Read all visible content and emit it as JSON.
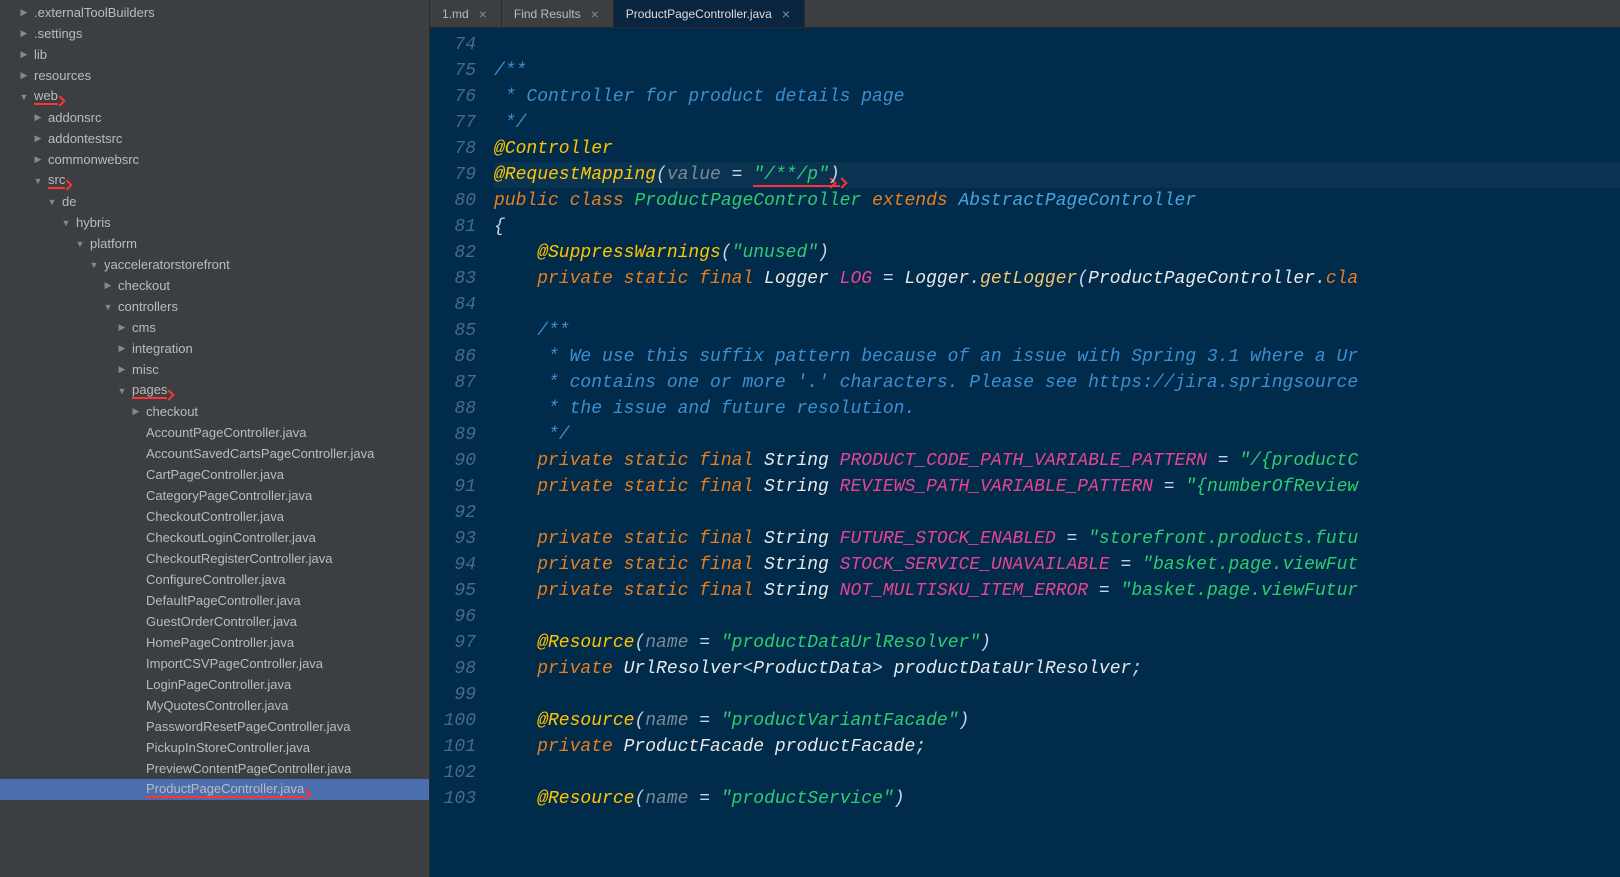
{
  "tabs": [
    {
      "label": "1.md",
      "active": false
    },
    {
      "label": "Find Results",
      "active": false
    },
    {
      "label": "ProductPageController.java",
      "active": true
    }
  ],
  "tree": [
    {
      "label": ".externalToolBuilders",
      "depth": 1,
      "arrow": "closed"
    },
    {
      "label": ".settings",
      "depth": 1,
      "arrow": "closed"
    },
    {
      "label": "lib",
      "depth": 1,
      "arrow": "closed"
    },
    {
      "label": "resources",
      "depth": 1,
      "arrow": "closed"
    },
    {
      "label": "web",
      "depth": 1,
      "arrow": "open",
      "red": true
    },
    {
      "label": "addonsrc",
      "depth": 2,
      "arrow": "closed"
    },
    {
      "label": "addontestsrc",
      "depth": 2,
      "arrow": "closed"
    },
    {
      "label": "commonwebsrc",
      "depth": 2,
      "arrow": "closed"
    },
    {
      "label": "src",
      "depth": 2,
      "arrow": "open",
      "red": true
    },
    {
      "label": "de",
      "depth": 3,
      "arrow": "open"
    },
    {
      "label": "hybris",
      "depth": 4,
      "arrow": "open"
    },
    {
      "label": "platform",
      "depth": 5,
      "arrow": "open"
    },
    {
      "label": "yacceleratorstorefront",
      "depth": 6,
      "arrow": "open"
    },
    {
      "label": "checkout",
      "depth": 7,
      "arrow": "closed"
    },
    {
      "label": "controllers",
      "depth": 7,
      "arrow": "open"
    },
    {
      "label": "cms",
      "depth": 8,
      "arrow": "closed"
    },
    {
      "label": "integration",
      "depth": 8,
      "arrow": "closed"
    },
    {
      "label": "misc",
      "depth": 8,
      "arrow": "closed"
    },
    {
      "label": "pages",
      "depth": 8,
      "arrow": "open",
      "red": true
    },
    {
      "label": "checkout",
      "depth": 9,
      "arrow": "closed"
    },
    {
      "label": "AccountPageController.java",
      "depth": 9
    },
    {
      "label": "AccountSavedCartsPageController.java",
      "depth": 9
    },
    {
      "label": "CartPageController.java",
      "depth": 9
    },
    {
      "label": "CategoryPageController.java",
      "depth": 9
    },
    {
      "label": "CheckoutController.java",
      "depth": 9
    },
    {
      "label": "CheckoutLoginController.java",
      "depth": 9
    },
    {
      "label": "CheckoutRegisterController.java",
      "depth": 9
    },
    {
      "label": "ConfigureController.java",
      "depth": 9
    },
    {
      "label": "DefaultPageController.java",
      "depth": 9
    },
    {
      "label": "GuestOrderController.java",
      "depth": 9
    },
    {
      "label": "HomePageController.java",
      "depth": 9
    },
    {
      "label": "ImportCSVPageController.java",
      "depth": 9
    },
    {
      "label": "LoginPageController.java",
      "depth": 9
    },
    {
      "label": "MyQuotesController.java",
      "depth": 9
    },
    {
      "label": "PasswordResetPageController.java",
      "depth": 9
    },
    {
      "label": "PickupInStoreController.java",
      "depth": 9
    },
    {
      "label": "PreviewContentPageController.java",
      "depth": 9
    },
    {
      "label": "ProductPageController.java",
      "depth": 9,
      "red": true,
      "selected": true
    }
  ],
  "code": {
    "lines": [
      {
        "n": 74,
        "tokens": []
      },
      {
        "n": 75,
        "tokens": [
          {
            "t": "/**",
            "c": "c-comment"
          }
        ]
      },
      {
        "n": 76,
        "tokens": [
          {
            "t": " * Controller for product details page",
            "c": "c-comment"
          }
        ]
      },
      {
        "n": 77,
        "tokens": [
          {
            "t": " */",
            "c": "c-comment"
          }
        ]
      },
      {
        "n": 78,
        "tokens": [
          {
            "t": "@Controller",
            "c": "c-annotation"
          }
        ]
      },
      {
        "n": 79,
        "hl": true,
        "tokens": [
          {
            "t": "@RequestMapping",
            "c": "c-annotation"
          },
          {
            "t": "(",
            "c": "c-punc"
          },
          {
            "t": "value ",
            "c": "c-gray"
          },
          {
            "t": "= ",
            "c": "c-punc"
          },
          {
            "t": "\"/**/p\"",
            "c": "c-string",
            "u": true
          },
          {
            "t": ")",
            "c": "c-punc",
            "u": true
          }
        ]
      },
      {
        "n": 80,
        "tokens": [
          {
            "t": "public ",
            "c": "c-keyword"
          },
          {
            "t": "class ",
            "c": "c-keyword"
          },
          {
            "t": "ProductPageController ",
            "c": "c-class"
          },
          {
            "t": "extends ",
            "c": "c-keyword"
          },
          {
            "t": "AbstractPageController",
            "c": "c-classref"
          }
        ]
      },
      {
        "n": 81,
        "tokens": [
          {
            "t": "{",
            "c": "c-punc"
          }
        ]
      },
      {
        "n": 82,
        "tokens": [
          {
            "t": "    @SuppressWarnings",
            "c": "c-annotation"
          },
          {
            "t": "(",
            "c": "c-punc"
          },
          {
            "t": "\"unused\"",
            "c": "c-string"
          },
          {
            "t": ")",
            "c": "c-punc"
          }
        ]
      },
      {
        "n": 83,
        "tokens": [
          {
            "t": "    private static final ",
            "c": "c-keyword"
          },
          {
            "t": "Logger ",
            "c": "c-white"
          },
          {
            "t": "LOG ",
            "c": "c-field"
          },
          {
            "t": "= ",
            "c": "c-punc"
          },
          {
            "t": "Logger",
            "c": "c-white"
          },
          {
            "t": ".",
            "c": "c-punc"
          },
          {
            "t": "getLogger",
            "c": "c-method"
          },
          {
            "t": "(",
            "c": "c-punc"
          },
          {
            "t": "ProductPageController",
            "c": "c-white"
          },
          {
            "t": ".",
            "c": "c-punc"
          },
          {
            "t": "cla",
            "c": "c-keyword"
          }
        ]
      },
      {
        "n": 84,
        "tokens": []
      },
      {
        "n": 85,
        "tokens": [
          {
            "t": "    /**",
            "c": "c-comment"
          }
        ]
      },
      {
        "n": 86,
        "tokens": [
          {
            "t": "     * We use this suffix pattern because of an issue with Spring 3.1 where a Ur",
            "c": "c-comment"
          }
        ]
      },
      {
        "n": 87,
        "tokens": [
          {
            "t": "     * contains one or more '.' characters. Please see https://jira.springsource",
            "c": "c-comment"
          }
        ]
      },
      {
        "n": 88,
        "tokens": [
          {
            "t": "     * the issue and future resolution.",
            "c": "c-comment"
          }
        ]
      },
      {
        "n": 89,
        "tokens": [
          {
            "t": "     */",
            "c": "c-comment"
          }
        ]
      },
      {
        "n": 90,
        "tokens": [
          {
            "t": "    private static final ",
            "c": "c-keyword"
          },
          {
            "t": "String ",
            "c": "c-white"
          },
          {
            "t": "PRODUCT_CODE_PATH_VARIABLE_PATTERN ",
            "c": "c-field"
          },
          {
            "t": "= ",
            "c": "c-punc"
          },
          {
            "t": "\"/{productC",
            "c": "c-string"
          }
        ]
      },
      {
        "n": 91,
        "tokens": [
          {
            "t": "    private static final ",
            "c": "c-keyword"
          },
          {
            "t": "String ",
            "c": "c-white"
          },
          {
            "t": "REVIEWS_PATH_VARIABLE_PATTERN ",
            "c": "c-field"
          },
          {
            "t": "= ",
            "c": "c-punc"
          },
          {
            "t": "\"{numberOfReview",
            "c": "c-string"
          }
        ]
      },
      {
        "n": 92,
        "tokens": []
      },
      {
        "n": 93,
        "tokens": [
          {
            "t": "    private static final ",
            "c": "c-keyword"
          },
          {
            "t": "String ",
            "c": "c-white"
          },
          {
            "t": "FUTURE_STOCK_ENABLED ",
            "c": "c-field"
          },
          {
            "t": "= ",
            "c": "c-punc"
          },
          {
            "t": "\"storefront.products.futu",
            "c": "c-string"
          }
        ]
      },
      {
        "n": 94,
        "tokens": [
          {
            "t": "    private static final ",
            "c": "c-keyword"
          },
          {
            "t": "String ",
            "c": "c-white"
          },
          {
            "t": "STOCK_SERVICE_UNAVAILABLE ",
            "c": "c-field"
          },
          {
            "t": "= ",
            "c": "c-punc"
          },
          {
            "t": "\"basket.page.viewFut",
            "c": "c-string"
          }
        ]
      },
      {
        "n": 95,
        "tokens": [
          {
            "t": "    private static final ",
            "c": "c-keyword"
          },
          {
            "t": "String ",
            "c": "c-white"
          },
          {
            "t": "NOT_MULTISKU_ITEM_ERROR ",
            "c": "c-field"
          },
          {
            "t": "= ",
            "c": "c-punc"
          },
          {
            "t": "\"basket.page.viewFutur",
            "c": "c-string"
          }
        ]
      },
      {
        "n": 96,
        "tokens": []
      },
      {
        "n": 97,
        "tokens": [
          {
            "t": "    @Resource",
            "c": "c-annotation"
          },
          {
            "t": "(",
            "c": "c-punc"
          },
          {
            "t": "name ",
            "c": "c-gray"
          },
          {
            "t": "= ",
            "c": "c-punc"
          },
          {
            "t": "\"productDataUrlResolver\"",
            "c": "c-string"
          },
          {
            "t": ")",
            "c": "c-punc"
          }
        ]
      },
      {
        "n": 98,
        "tokens": [
          {
            "t": "    private ",
            "c": "c-keyword"
          },
          {
            "t": "UrlResolver",
            "c": "c-white"
          },
          {
            "t": "<",
            "c": "c-punc"
          },
          {
            "t": "ProductData",
            "c": "c-white"
          },
          {
            "t": "> ",
            "c": "c-punc"
          },
          {
            "t": "productDataUrlResolver",
            "c": "c-white"
          },
          {
            "t": ";",
            "c": "c-punc"
          }
        ]
      },
      {
        "n": 99,
        "tokens": []
      },
      {
        "n": 100,
        "tokens": [
          {
            "t": "    @Resource",
            "c": "c-annotation"
          },
          {
            "t": "(",
            "c": "c-punc"
          },
          {
            "t": "name ",
            "c": "c-gray"
          },
          {
            "t": "= ",
            "c": "c-punc"
          },
          {
            "t": "\"productVariantFacade\"",
            "c": "c-string"
          },
          {
            "t": ")",
            "c": "c-punc"
          }
        ]
      },
      {
        "n": 101,
        "tokens": [
          {
            "t": "    private ",
            "c": "c-keyword"
          },
          {
            "t": "ProductFacade ",
            "c": "c-white"
          },
          {
            "t": "productFacade",
            "c": "c-white"
          },
          {
            "t": ";",
            "c": "c-punc"
          }
        ]
      },
      {
        "n": 102,
        "tokens": []
      },
      {
        "n": 103,
        "tokens": [
          {
            "t": "    @Resource",
            "c": "c-annotation"
          },
          {
            "t": "(",
            "c": "c-punc"
          },
          {
            "t": "name ",
            "c": "c-gray"
          },
          {
            "t": "= ",
            "c": "c-punc"
          },
          {
            "t": "\"productService\"",
            "c": "c-string"
          },
          {
            "t": ")",
            "c": "c-punc"
          }
        ]
      }
    ]
  }
}
